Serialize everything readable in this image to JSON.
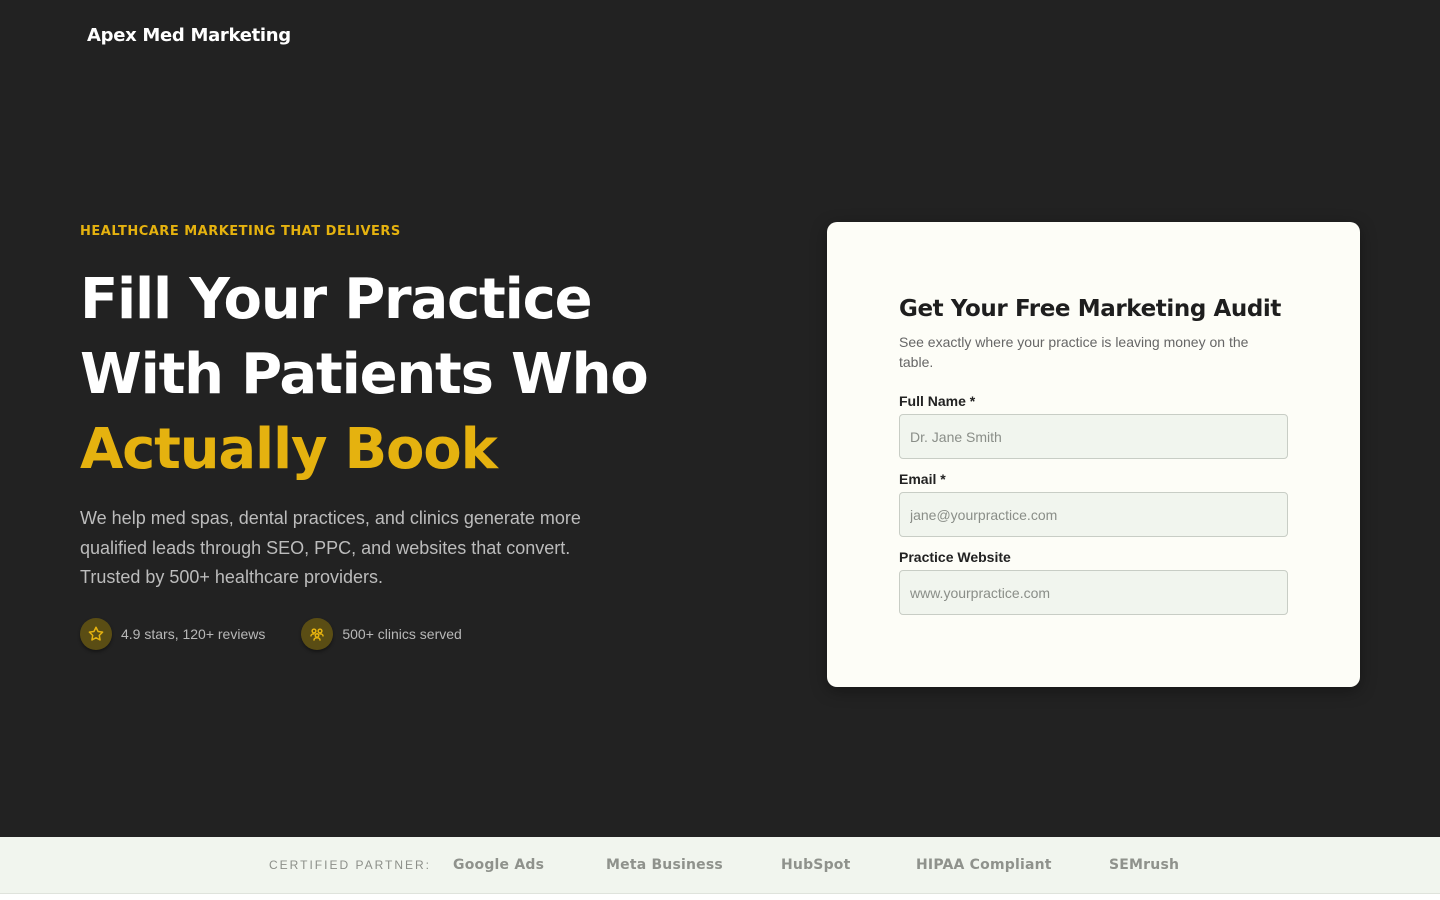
{
  "header": {
    "brand": "Apex Med Marketing"
  },
  "hero": {
    "eyebrow": "HEALTHCARE MARKETING THAT DELIVERS",
    "headline_line1": "Fill Your Practice",
    "headline_line2": "With Patients Who",
    "headline_accent": "Actually Book",
    "description": "We help med spas, dental practices, and clinics generate more qualified leads through SEO, PPC, and websites that convert. Trusted by 500+ healthcare providers.",
    "proof": [
      {
        "icon": "star-icon",
        "text": "4.9 stars, 120+ reviews"
      },
      {
        "icon": "users-icon",
        "text": "500+ clinics served"
      }
    ]
  },
  "form": {
    "title": "Get Your Free Marketing Audit",
    "subtitle": "See exactly where your practice is leaving money on the table.",
    "fields": [
      {
        "label": "Full Name *",
        "placeholder": "Dr. Jane Smith",
        "value": ""
      },
      {
        "label": "Email *",
        "placeholder": "jane@yourpractice.com",
        "value": ""
      },
      {
        "label": "Practice Website",
        "placeholder": "www.yourpractice.com",
        "value": ""
      }
    ]
  },
  "partners": {
    "label": "CERTIFIED PARTNER:",
    "items": [
      "Google Ads",
      "Meta Business",
      "HubSpot",
      "HIPAA Compliant",
      "SEMrush"
    ]
  },
  "colors": {
    "background": "#222222",
    "accent": "#e5b20f",
    "card": "#fdfdf7",
    "input": "#f1f5ee",
    "partner_bar": "#f1f5ee"
  }
}
